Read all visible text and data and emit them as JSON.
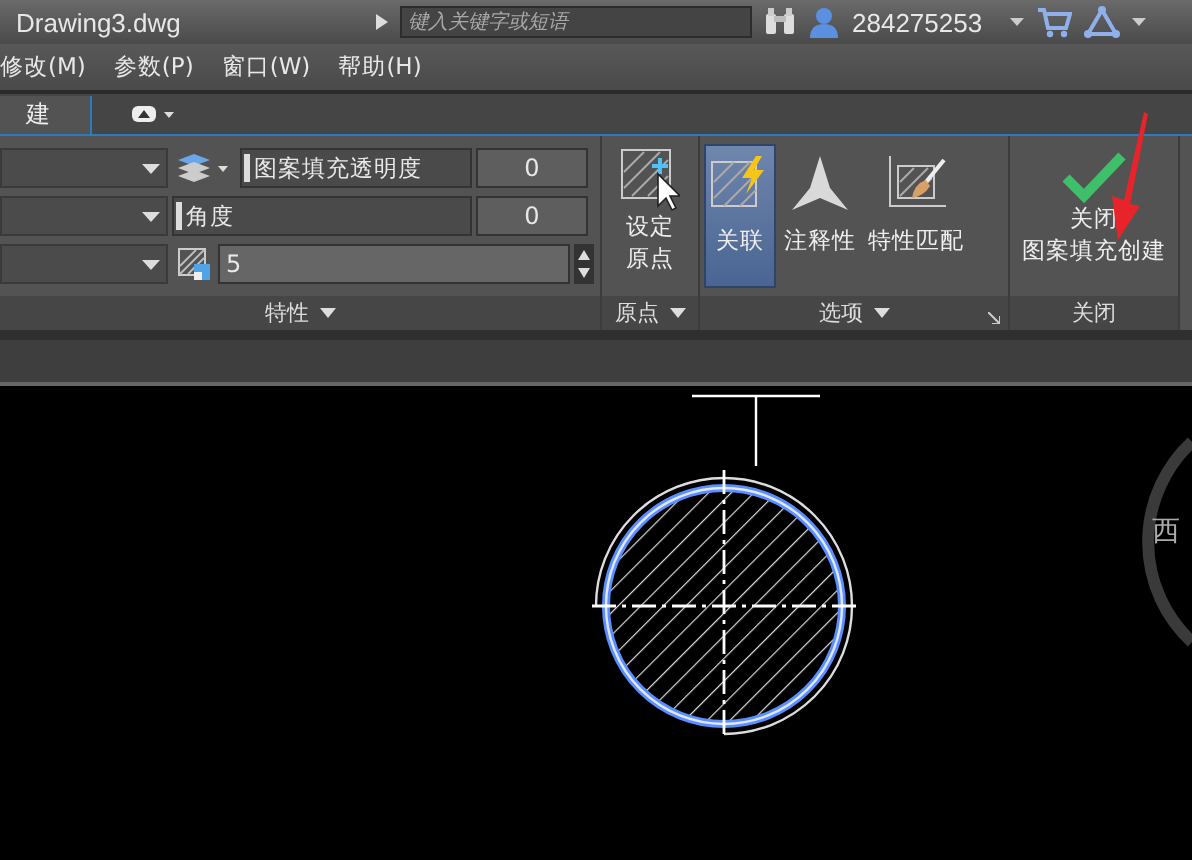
{
  "title_bar": {
    "filename": "Drawing3.dwg",
    "search_placeholder": "键入关键字或短语",
    "user": "284275253"
  },
  "menu": [
    "修改(M)",
    "参数(P)",
    "窗口(W)",
    "帮助(H)"
  ],
  "ribbon_tabs": [
    {
      "label": "建",
      "selected": true
    }
  ],
  "properties_panel": {
    "transparency": {
      "label": "图案填充透明度",
      "value": "0"
    },
    "angle": {
      "label": "角度",
      "value": "0"
    },
    "scale": {
      "value": "5"
    },
    "title": "特性"
  },
  "origin_panel": {
    "button_lines": [
      "设定",
      "原点"
    ],
    "title": "原点"
  },
  "options_panel": {
    "buttons": [
      {
        "kind": "associative",
        "label": "关联",
        "selected": true
      },
      {
        "kind": "annotative",
        "label": "注释性",
        "selected": false
      },
      {
        "kind": "match",
        "label": "特性匹配",
        "selected": false
      }
    ],
    "title": "选项"
  },
  "close_panel": {
    "button_lines": [
      "关闭",
      "图案填充创建"
    ],
    "title": "关闭"
  },
  "viewcube": {
    "direction": "西"
  }
}
